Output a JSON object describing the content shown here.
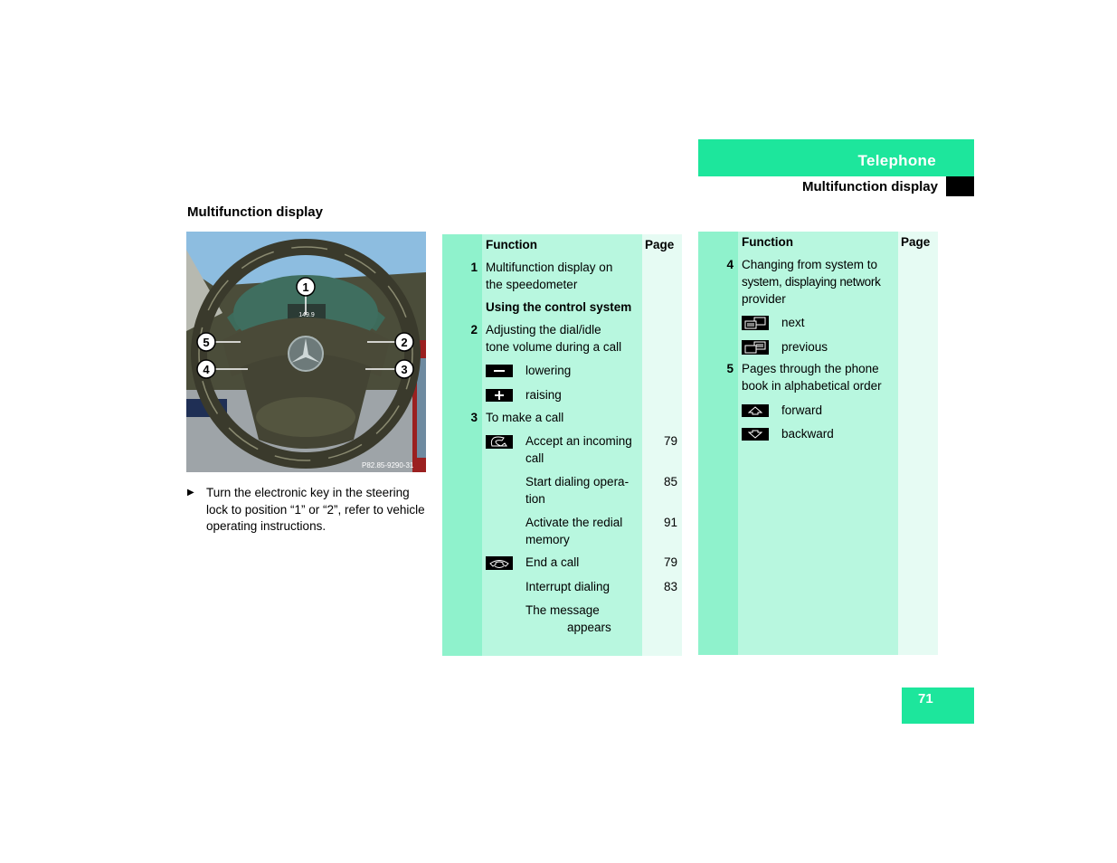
{
  "header": {
    "chapter": "Telephone",
    "subtitle": "Multifunction display"
  },
  "section_title": "Multifunction display",
  "illustration": {
    "callouts": [
      "1",
      "2",
      "3",
      "4",
      "5"
    ],
    "display_readout": "149.9",
    "code": "P82.85-9290-31"
  },
  "instruction": {
    "bullet": "▶",
    "text": "Turn the electronic key in the steering lock to position “1” or “2”, refer to vehicle operating instructions."
  },
  "table1": {
    "col_function": "Function",
    "col_page": "Page",
    "item1_num": "1",
    "item1_text_l1": "Multifunction display on",
    "item1_text_l2": "the speedometer",
    "subhead": "Using the control system",
    "item2_num": "2",
    "item2_text_l1": "Adjusting the dial/idle",
    "item2_text_l2": "tone volume during a call",
    "minus_label": "lowering",
    "plus_label": "raising",
    "item3_num": "3",
    "item3_text": "To make a call",
    "accept_l1": "Accept an incoming",
    "accept_l2": "call",
    "accept_page": "79",
    "start_l1": "Start dialing opera-",
    "start_l2": "tion",
    "start_page": "85",
    "redial_l1": "Activate the redial",
    "redial_l2": "memory",
    "redial_page": "91",
    "end_label": "End a call",
    "end_page": "79",
    "interrupt_label": "Interrupt dialing",
    "interrupt_page": "83",
    "message_l1": "The message",
    "message_l2": "appears"
  },
  "table2": {
    "col_function": "Function",
    "col_page": "Page",
    "item4_num": "4",
    "item4_l1": "Changing from system to",
    "item4_l2": "system, displaying network",
    "item4_l3": "provider",
    "next_label": "next",
    "previous_label": "previous",
    "item5_num": "5",
    "item5_l1": "Pages through the phone",
    "item5_l2": "book in alphabetical order",
    "forward_label": "forward",
    "backward_label": "backward"
  },
  "icons": {
    "minus": "minus-key-icon",
    "plus": "plus-key-icon",
    "accept": "phone-pickup-icon",
    "end": "phone-hangup-icon",
    "next": "next-system-icon",
    "previous": "previous-system-icon",
    "forward": "arrow-up-icon",
    "backward": "arrow-down-icon"
  },
  "colors": {
    "accent": "#1de69c",
    "col_num": "#8ff2cc",
    "col_function": "#b8f7df",
    "col_page": "#e6fbf3"
  },
  "page_number": "71"
}
